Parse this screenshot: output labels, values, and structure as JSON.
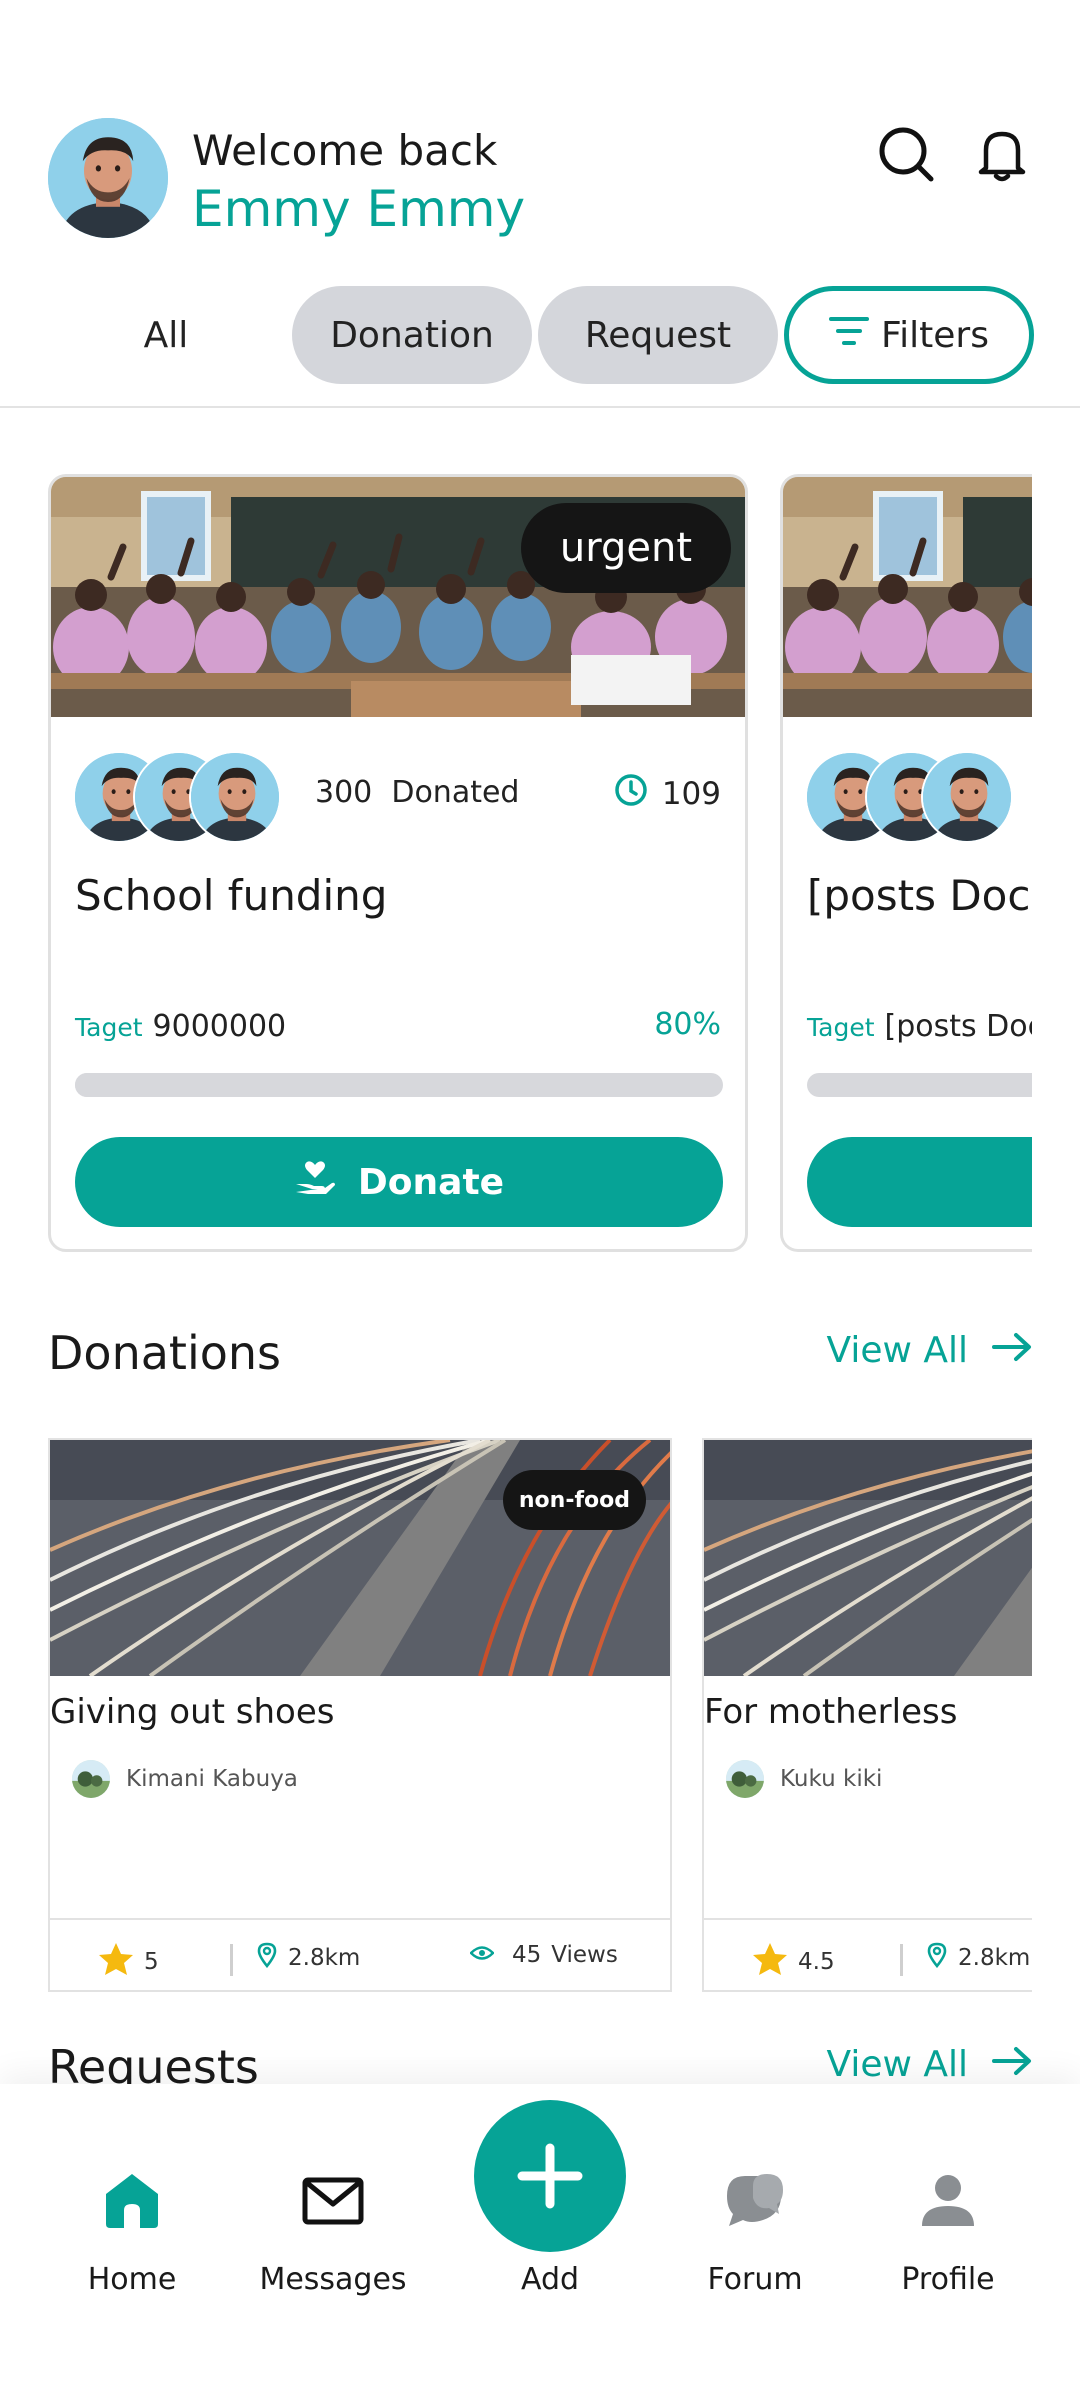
{
  "colors": {
    "accent": "#06a396",
    "chip_gray": "#d4d6db",
    "badge_dark": "#151515"
  },
  "header": {
    "welcome": "Welcome back",
    "username": "Emmy Emmy",
    "icons": [
      "search-icon",
      "bell-icon"
    ]
  },
  "tabs": {
    "all": "All",
    "donation": "Donation",
    "request": "Request",
    "filters": "Filters"
  },
  "campaigns": [
    {
      "badge": "urgent",
      "donated_count": "300",
      "donated_label": "Donated",
      "days_left": "109",
      "title": "School funding",
      "target_label": "Taget",
      "target_value": "9000000",
      "percent": "80%",
      "progress_fraction": 0.8,
      "button": "Donate"
    },
    {
      "title": "[posts Docu",
      "target_label": "Taget",
      "target_value": "[posts Docu"
    }
  ],
  "donations_section": {
    "title": "Donations",
    "view_all": "View All"
  },
  "donations": [
    {
      "tag": "non-food",
      "title": "Giving out shoes",
      "donor": "Kimani Kabuya",
      "rating": "5",
      "distance": "2.8km",
      "views": "45",
      "views_label": "Views"
    },
    {
      "title": "For motherless",
      "donor": "Kuku kiki",
      "rating": "4.5",
      "distance": "2.8km"
    }
  ],
  "requests_section": {
    "title": "Requests",
    "view_all": "View All"
  },
  "bottom_nav": {
    "home": "Home",
    "messages": "Messages",
    "add": "Add",
    "forum": "Forum",
    "profile": "Profile"
  }
}
